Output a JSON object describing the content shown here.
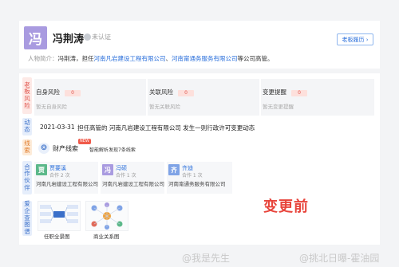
{
  "person": {
    "avatar_char": "冯",
    "name": "冯荆涛",
    "verify_label": "未认证",
    "history_button": "老板履历 ›"
  },
  "intro": {
    "label": "人物简介：",
    "prefix": "冯荆涛，担任",
    "company1": "河南凡岩建设工程有限公司",
    "sep": "、",
    "company2": "河南甯通务服务有限公司",
    "suffix": "等公司高管。"
  },
  "sections": {
    "boss_risk": "老板风险",
    "news": "动态",
    "clue": "线索",
    "partner": "合作伙伴",
    "graph": "爱企查图谱"
  },
  "risks": [
    {
      "title": "自身风险",
      "count": "0",
      "empty": "暂无自身风险"
    },
    {
      "title": "关联风险",
      "count": "0",
      "empty": "暂无关联风险"
    },
    {
      "title": "变更提醒",
      "count": "0",
      "empty": "暂无变更提醒"
    }
  ],
  "news": {
    "date": "2021-03-31",
    "text": "担任高管的 河南凡岩建设工程有限公司 发生一则行政许可变更动态"
  },
  "clue": {
    "title": "财产线索",
    "badge": "NEW",
    "subtitle": "智能解析发现7条线索"
  },
  "partners": [
    {
      "avatar": "贾",
      "name": "贾要溪",
      "count": "合作 2 次",
      "company": "河南凡岩建设工程有限公司",
      "color": "#5cb88a"
    },
    {
      "avatar": "冯",
      "name": "冯硕",
      "count": "合作 1 次",
      "company": "河南凡岩建设工程有限公司",
      "color": "#a99be0"
    },
    {
      "avatar": "齐",
      "name": "齐迪",
      "count": "合作 1 次",
      "company": "河南甯通务服务有限公司",
      "color": "#7fa3e6"
    }
  ],
  "graphs": [
    {
      "label": "任职全景图"
    },
    {
      "label": "商业关系图"
    }
  ],
  "stamp": "变更前",
  "watermarks": {
    "left": "@我是先生",
    "right": "@挑北日曝-霍油园"
  },
  "colors": {
    "accent": "#2a6fdb",
    "risk": "#e0524a",
    "stamp": "#e8453c"
  }
}
